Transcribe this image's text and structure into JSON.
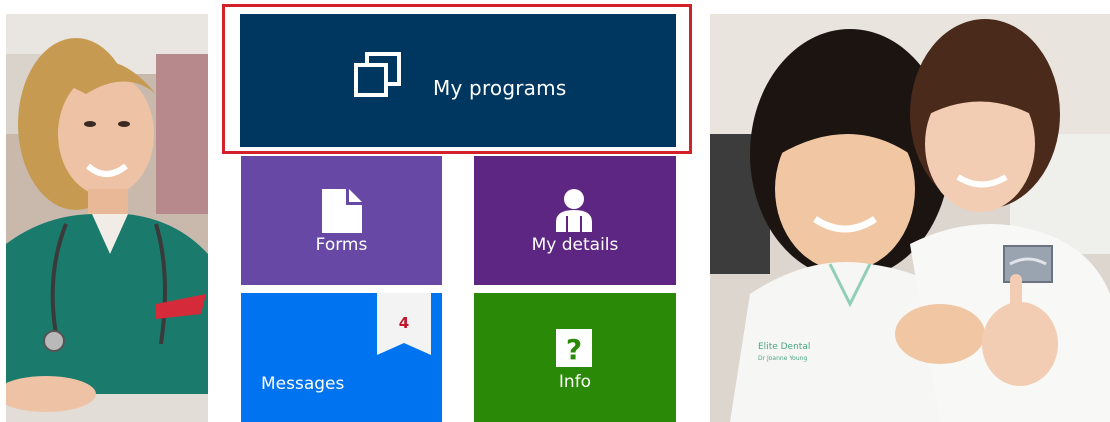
{
  "tiles": {
    "programs": {
      "label": "My programs",
      "icon": "copy-windows-icon",
      "color": "#003760",
      "highlight_color": "#d4202a"
    },
    "forms": {
      "label": "Forms",
      "icon": "document-icon",
      "color": "#6749a5"
    },
    "details": {
      "label": "My details",
      "icon": "person-icon",
      "color": "#5e2683"
    },
    "messages": {
      "label": "Messages",
      "icon": "ribbon-badge-icon",
      "color": "#0074f0",
      "badge_count": "4"
    },
    "info": {
      "label": "Info",
      "icon": "question-icon",
      "color": "#2a8a08"
    }
  },
  "photos": {
    "left": {
      "subject": "nurse-photo"
    },
    "right": {
      "subject": "dental-students-photo",
      "uniform_text": "Elite Dental",
      "name_text": "Dr Joanne Young"
    }
  }
}
